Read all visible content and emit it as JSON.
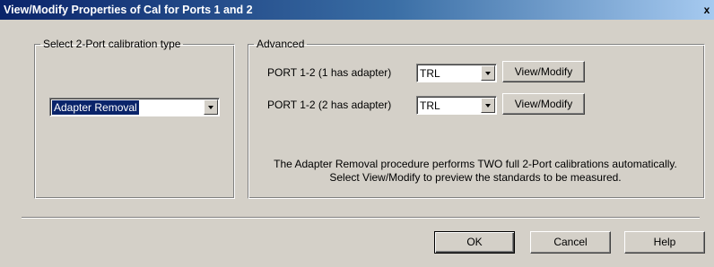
{
  "window": {
    "title": "View/Modify Properties of Cal for Ports 1 and 2",
    "close_glyph": "x"
  },
  "cal_type": {
    "legend": "Select 2-Port calibration type",
    "selected": "Adapter Removal"
  },
  "advanced": {
    "legend": "Advanced",
    "rows": [
      {
        "label": "PORT 1-2 (1 has adapter)",
        "value": "TRL",
        "button": "View/Modify"
      },
      {
        "label": "PORT 1-2 (2 has adapter)",
        "value": "TRL",
        "button": "View/Modify"
      }
    ],
    "info_line1": "The Adapter Removal procedure performs TWO full 2-Port calibrations automatically.",
    "info_line2": "Select View/Modify to preview the standards to be measured."
  },
  "footer": {
    "ok": "OK",
    "cancel": "Cancel",
    "help": "Help"
  },
  "colors": {
    "title_bar_start": "#0a246a",
    "title_bar_end": "#a6caf0",
    "dialog_face": "#d4d0c8",
    "selection": "#0a246a"
  }
}
